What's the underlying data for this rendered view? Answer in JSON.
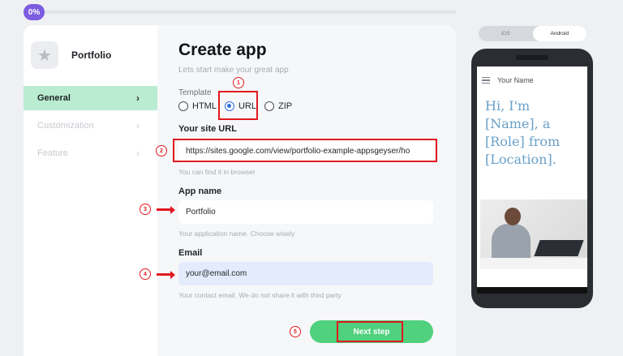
{
  "progress": {
    "label": "0%",
    "percent": 0
  },
  "sidebar": {
    "app_name": "Portfolio",
    "items": [
      {
        "label": "General",
        "state": "active"
      },
      {
        "label": "Customization",
        "state": "disabled"
      },
      {
        "label": "Feature",
        "state": "disabled"
      }
    ]
  },
  "form": {
    "title": "Create app",
    "subtitle": "Lets start make your great app",
    "template_label": "Template",
    "template_options": [
      "HTML",
      "URL",
      "ZIP"
    ],
    "template_selected": "URL",
    "url_label": "Your site URL",
    "url_value": "https://sites.google.com/view/portfolio-example-appsgeyser/ho",
    "url_help": "You can find it in browser",
    "app_name_label": "App name",
    "app_name_value": "Portfolio",
    "app_name_help": "Your application name. Choose wisely",
    "email_label": "Email",
    "email_value": "your@email.com",
    "email_help": "Your contact email. We do not share it with third party",
    "next_label": "Next step"
  },
  "annotations": {
    "badges": [
      "1",
      "2",
      "3",
      "4",
      "5"
    ],
    "color": "#e0191f"
  },
  "preview": {
    "os_options": [
      "iOS",
      "Android"
    ],
    "os_selected": "Android",
    "site_name": "Your Name",
    "hero_text": "Hi, I'm [Name], a [Role] from [Location]."
  },
  "colors": {
    "accent_green": "#4fd17d",
    "active_nav": "#b9ecd1",
    "progress_badge": "#7c5ce0",
    "radio_selected": "#2f6fe0"
  }
}
